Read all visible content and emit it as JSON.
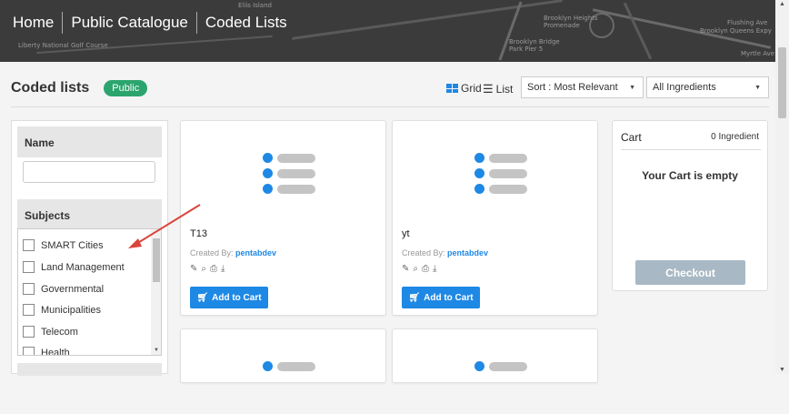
{
  "header": {
    "breadcrumbs": [
      "Home",
      "Public Catalogue",
      "Coded Lists"
    ],
    "map_labels": [
      "Liberty National Golf Course",
      "Brooklyn Heights Promenade",
      "Brooklyn Bridge Park Pier 5",
      "Flushing Ave",
      "Brooklyn Queens Expy",
      "Myrtle Ave",
      "Eliis Island"
    ]
  },
  "page": {
    "title": "Coded lists",
    "badge": "Public",
    "grid_label": "Grid",
    "list_label": "List",
    "sort_value": "Sort : Most Relevant",
    "ingredient_filter_value": "All Ingredients"
  },
  "filters": {
    "name_heading": "Name",
    "name_value": "",
    "subjects_heading": "Subjects",
    "subjects": [
      "SMART Cities",
      "Land Management",
      "Governmental",
      "Municipalities",
      "Telecom",
      "Health"
    ]
  },
  "cards": [
    {
      "title": "T13",
      "created_by_label": "Created By:",
      "author": "pentabdev",
      "button": "Add to Cart"
    },
    {
      "title": "yt",
      "created_by_label": "Created By:",
      "author": "pentabdev",
      "button": "Add to Cart"
    }
  ],
  "cart": {
    "title": "Cart",
    "count": "0 Ingredient",
    "empty_message": "Your Cart is empty",
    "checkout": "Checkout"
  },
  "colors": {
    "accent": "#1e88e5",
    "badge": "#2ba56d",
    "checkout_disabled": "#a8b8c4",
    "annotation_arrow": "#d9453b"
  }
}
